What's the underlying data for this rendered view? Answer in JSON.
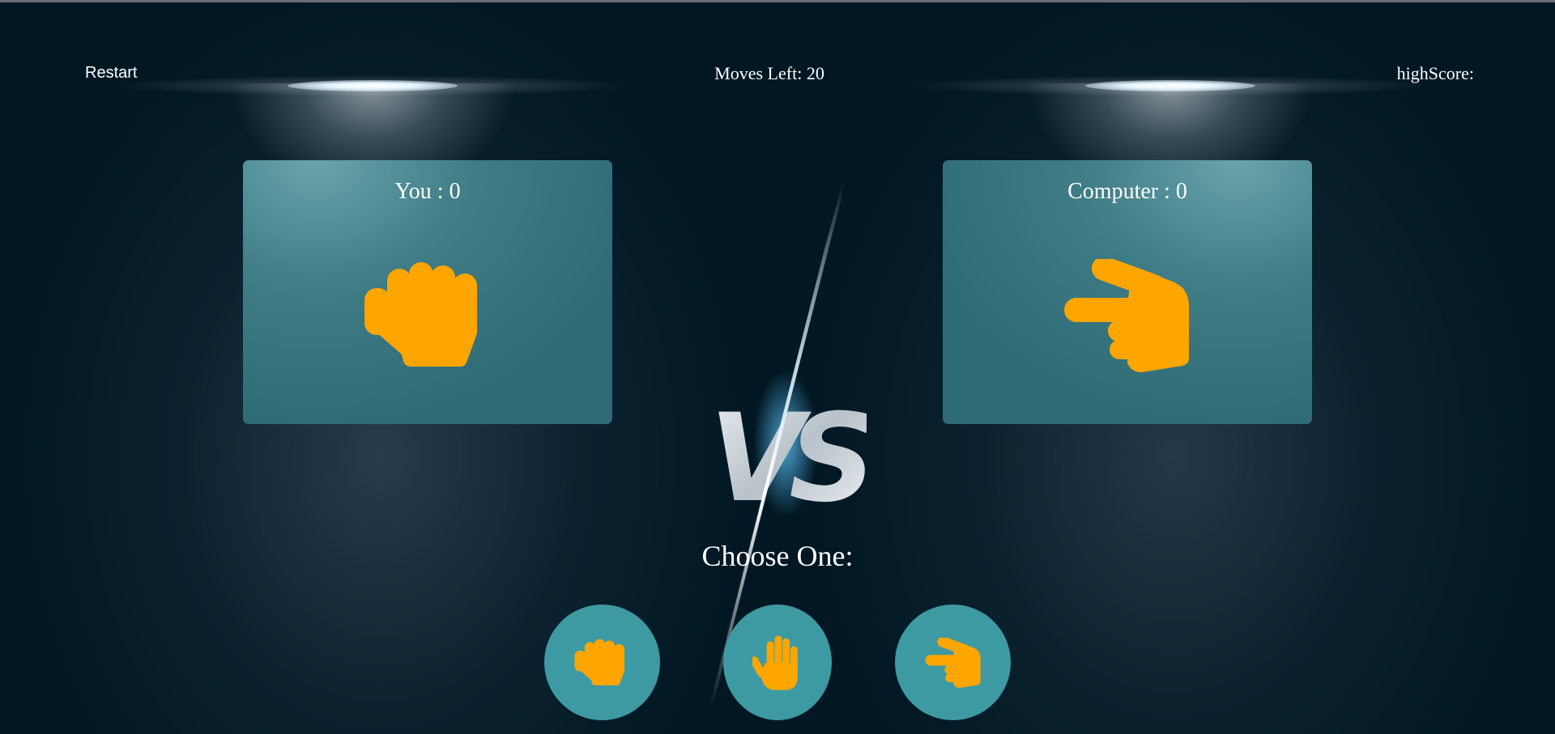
{
  "header": {
    "restart_label": "Restart",
    "moves_label": "Moves Left: 20",
    "highscore_label": "highScore:",
    "highscore_value": ""
  },
  "player_card": {
    "title": "You : 0",
    "hand_icon": "fist-icon"
  },
  "computer_card": {
    "title": "Computer : 0",
    "hand_icon": "scissors-hand-icon"
  },
  "versus": {
    "label": "VS"
  },
  "choices": {
    "prompt": "Choose One:",
    "options": [
      {
        "name": "rock",
        "icon": "fist-icon"
      },
      {
        "name": "paper",
        "icon": "open-hand-icon"
      },
      {
        "name": "scissors",
        "icon": "scissors-hand-icon"
      }
    ]
  },
  "colors": {
    "background": "#011824",
    "card": "#3f7d87",
    "choice_button": "#3e9aa2",
    "hand": "#ffa500",
    "text": "#ffffff"
  }
}
